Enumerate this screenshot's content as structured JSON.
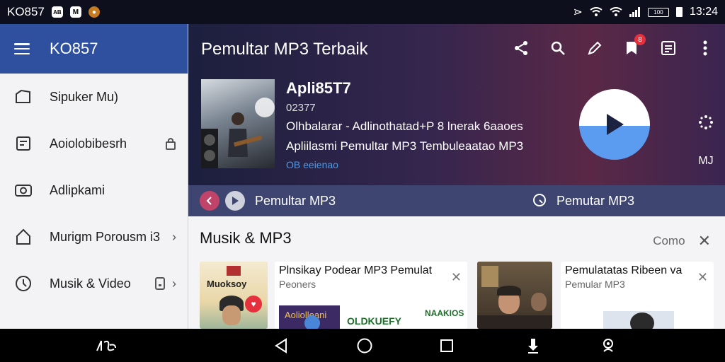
{
  "status": {
    "carrier": "KO857",
    "badge1": "AB",
    "badge2": "M",
    "battery_text": "100",
    "time": "13:24"
  },
  "drawer": {
    "title": "KO857",
    "items": [
      {
        "label": "Sipuker Mu)",
        "icon": "folder-icon"
      },
      {
        "label": "Aoiolobibesrh",
        "icon": "document-icon"
      },
      {
        "label": "Adlipkami",
        "icon": "camera-icon"
      },
      {
        "label": "Murigm Porousm i3",
        "icon": "home-icon"
      },
      {
        "label": "Musik & Video",
        "icon": "clock-icon"
      }
    ]
  },
  "header": {
    "title": "Pemultar MP3 Terbaik",
    "badge_count": "8"
  },
  "track": {
    "title": "Apli85T7",
    "number": "02377",
    "line1": "Olhbalarar - Adlinothatad+P 8 lnerak 6aaoes",
    "line2": "Apliilasmi Pemultar MP3 Tembuleaatao MP3",
    "link": "OB eeienao"
  },
  "side": {
    "label": "MJ"
  },
  "nowbar": {
    "label": "Pemultar MP3",
    "right_label": "Pemutar MP3"
  },
  "section": {
    "title": "Musik & MP3",
    "more": "Como"
  },
  "cards": [
    {
      "cover_text": "Muoksoy"
    },
    {
      "title": "Plnsikay Podear MP3 Pemulat",
      "sub": "Peoners",
      "banner": "Aoliolleani",
      "banner2": "OLDKUEFY",
      "banner3": "NAAKIOS"
    },
    {},
    {
      "title": "Pemulatatas Ribeen va",
      "sub": "Pemular MP3"
    }
  ],
  "colors": {
    "drawer_header": "#2f4f9f",
    "play_blue": "#5b9cf0",
    "nowbar": "#3e4570",
    "badge_red": "#e5303d"
  }
}
